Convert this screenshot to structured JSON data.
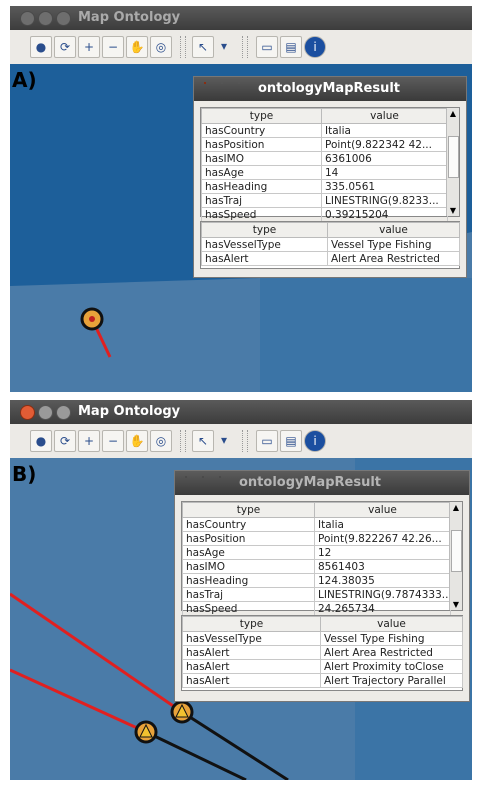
{
  "panel_a": {
    "window_title": "Map Ontology",
    "label": "A)",
    "dialog_title": "ontologyMapResult",
    "table1": {
      "headers": [
        "type",
        "value"
      ],
      "rows": [
        [
          "hasCountry",
          "Italia"
        ],
        [
          "hasPosition",
          "Point(9.822342 42..."
        ],
        [
          "hasIMO",
          "6361006"
        ],
        [
          "hasAge",
          "14"
        ],
        [
          "hasHeading",
          "335.0561"
        ],
        [
          "hasTraj",
          "LINESTRING(9.8233..."
        ],
        [
          "hasSpeed",
          "0.39215204"
        ]
      ]
    },
    "table2": {
      "headers": [
        "type",
        "value"
      ],
      "rows": [
        [
          "hasVesselType",
          "Vessel Type Fishing"
        ],
        [
          "hasAlert",
          "Alert Area Restricted"
        ]
      ]
    }
  },
  "panel_b": {
    "window_title": "Map Ontology",
    "label": "B)",
    "dialog_title": "ontologyMapResult",
    "table1": {
      "headers": [
        "type",
        "value"
      ],
      "rows": [
        [
          "hasCountry",
          "Italia"
        ],
        [
          "hasPosition",
          "Point(9.822267 42.26..."
        ],
        [
          "hasAge",
          "12"
        ],
        [
          "hasIMO",
          "8561403"
        ],
        [
          "hasHeading",
          "124.38035"
        ],
        [
          "hasTraj",
          "LINESTRING(9.7874333..."
        ],
        [
          "hasSpeed",
          "24.265734"
        ]
      ]
    },
    "table2": {
      "headers": [
        "type",
        "value"
      ],
      "rows": [
        [
          "hasVesselType",
          "Vessel Type Fishing"
        ],
        [
          "hasAlert",
          "Alert Area Restricted"
        ],
        [
          "hasAlert",
          "Alert Proximity toClose"
        ],
        [
          "hasAlert",
          "Alert Trajectory Parallel"
        ]
      ]
    }
  },
  "colors": {
    "sea": "#4a7ba8",
    "sea_dark": "#1d5f9a",
    "vessel_marker": "#e8a23a",
    "trajectory_alert": "#e02020",
    "trajectory": "#111111"
  },
  "toolbar_icons": [
    "globe-icon",
    "refresh-icon",
    "zoom-in-icon",
    "zoom-out-icon",
    "pan-hand-icon",
    "world-icon",
    "pointer-icon",
    "dropdown-icon",
    "map-layer-icon",
    "map-print-icon",
    "info-icon"
  ]
}
